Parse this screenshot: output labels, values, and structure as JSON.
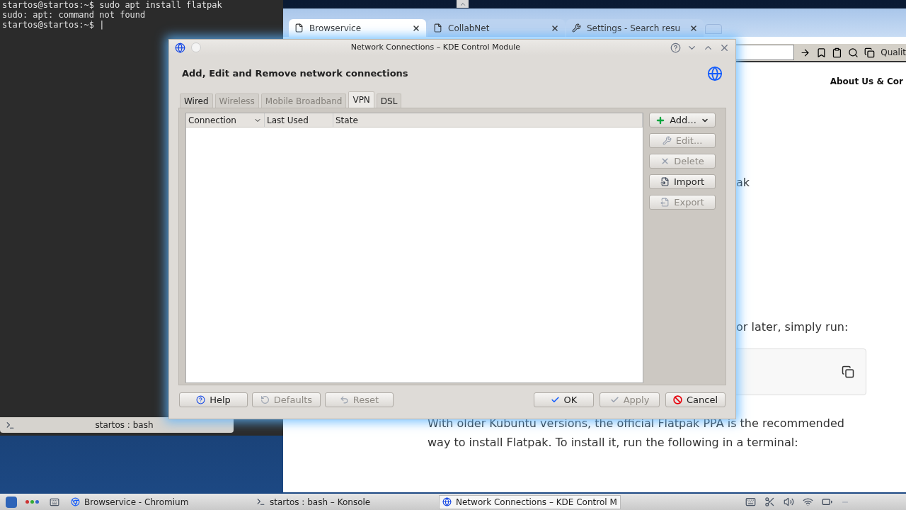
{
  "terminal": {
    "lines": [
      "startos@startos:~$ sudo apt install flatpak",
      "sudo: apt: command not found",
      "startos@startos:~$ |"
    ],
    "tab_label": "startos : bash"
  },
  "browser": {
    "tabs": [
      {
        "label": "Browservice",
        "selected": true
      },
      {
        "label": "CollabNet",
        "selected": false
      },
      {
        "label": "Settings - Search resu",
        "selected": false
      }
    ],
    "toolbar_label": "Qualit",
    "heading": "About Us & Cor",
    "fragment": "ak",
    "lead": "or later, simply run:",
    "paragraph": "With older Kubuntu versions, the official Flatpak PPA is the recommended way to install Flatpak. To install it, run the following in a terminal:"
  },
  "dialog": {
    "title": "Network Connections – KDE Control Module",
    "heading": "Add, Edit and Remove network connections",
    "tabs": [
      {
        "label": "Wired",
        "selected": false,
        "disabled": false
      },
      {
        "label": "Wireless",
        "selected": false,
        "disabled": true
      },
      {
        "label": "Mobile Broadband",
        "selected": false,
        "disabled": true
      },
      {
        "label": "VPN",
        "selected": true,
        "disabled": false
      },
      {
        "label": "DSL",
        "selected": false,
        "disabled": false
      }
    ],
    "columns": [
      "Connection",
      "Last Used",
      "State"
    ],
    "side_buttons": [
      {
        "label": "Add...",
        "disabled": false
      },
      {
        "label": "Edit...",
        "disabled": true
      },
      {
        "label": "Delete",
        "disabled": true
      },
      {
        "label": "Import",
        "disabled": false
      },
      {
        "label": "Export",
        "disabled": true
      }
    ],
    "footer_left": [
      {
        "label": "Help",
        "disabled": false
      },
      {
        "label": "Defaults",
        "disabled": true
      },
      {
        "label": "Reset",
        "disabled": true
      }
    ],
    "footer_right": [
      {
        "label": "OK",
        "disabled": false
      },
      {
        "label": "Apply",
        "disabled": true
      },
      {
        "label": "Cancel",
        "disabled": false
      }
    ]
  },
  "taskbar": {
    "tasks": [
      {
        "label": "Browservice - Chromium",
        "selected": false
      },
      {
        "label": "startos : bash – Konsole",
        "selected": false
      },
      {
        "label": "Network Connections – KDE Control M",
        "selected": true
      }
    ]
  }
}
